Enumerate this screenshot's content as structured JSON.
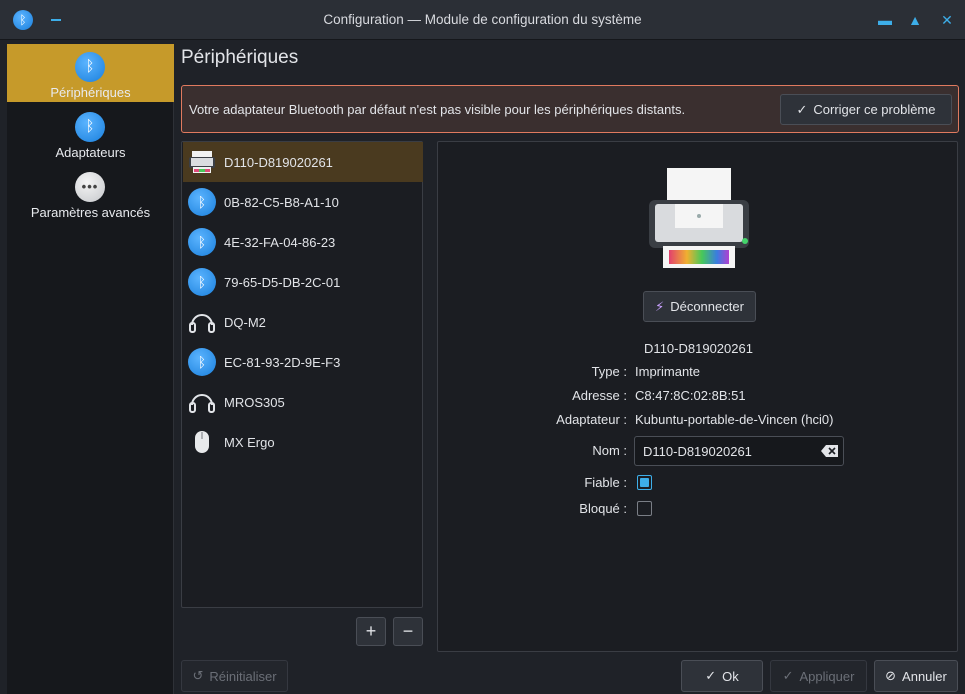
{
  "window": {
    "title": "Configuration — Module de configuration du système"
  },
  "sidebar": {
    "items": [
      {
        "label": "Périphériques",
        "icon": "bluetooth-icon",
        "active": true
      },
      {
        "label": "Adaptateurs",
        "icon": "bluetooth-icon",
        "active": false
      },
      {
        "label": "Paramètres avancés",
        "icon": "more-icon",
        "active": false
      }
    ]
  },
  "main": {
    "title": "Périphériques",
    "banner": {
      "message": "Votre adaptateur Bluetooth par défaut n'est pas visible pour les périphériques distants.",
      "fix_label": "Corriger ce problème"
    },
    "devices": [
      {
        "name": "D110-D819020261",
        "icon": "printer-icon",
        "active": true
      },
      {
        "name": "0B-82-C5-B8-A1-10",
        "icon": "bluetooth-icon",
        "active": false
      },
      {
        "name": "4E-32-FA-04-86-23",
        "icon": "bluetooth-icon",
        "active": false
      },
      {
        "name": "79-65-D5-DB-2C-01",
        "icon": "bluetooth-icon",
        "active": false
      },
      {
        "name": "DQ-M2",
        "icon": "headset-icon",
        "active": false
      },
      {
        "name": "EC-81-93-2D-9E-F3",
        "icon": "bluetooth-icon",
        "active": false
      },
      {
        "name": "MROS305",
        "icon": "headset-icon",
        "active": false
      },
      {
        "name": "MX Ergo",
        "icon": "mouse-icon",
        "active": false
      }
    ],
    "add_label": "+",
    "remove_label": "−",
    "detail": {
      "disconnect_label": "Déconnecter",
      "device_name": "D110-D819020261",
      "type_label": "Type :",
      "type_value": "Imprimante",
      "address_label": "Adresse :",
      "address_value": "C8:47:8C:02:8B:51",
      "adapter_label": "Adaptateur :",
      "adapter_value": "Kubuntu-portable-de-Vincen (hci0)",
      "name_label": "Nom :",
      "name_value": "D110-D819020261",
      "trusted_label": "Fiable :",
      "trusted": true,
      "blocked_label": "Bloqué :",
      "blocked": false
    }
  },
  "footer": {
    "reset_label": "Réinitialiser",
    "ok_label": "Ok",
    "apply_label": "Appliquer",
    "cancel_label": "Annuler"
  },
  "colors": {
    "accent": "#3daee9",
    "selection": "#c69a2a",
    "warning_border": "#e07a5f"
  }
}
